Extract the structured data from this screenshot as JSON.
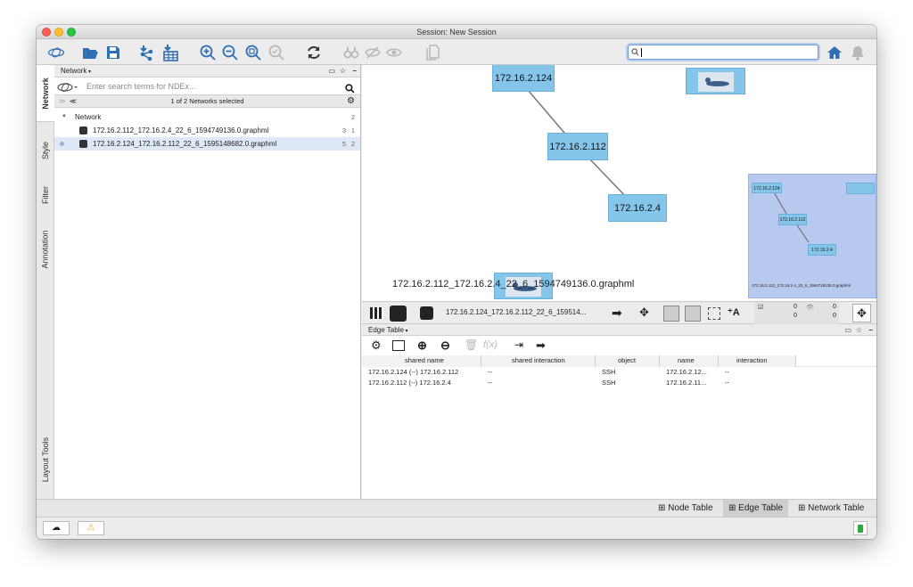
{
  "window": {
    "title": "Session: New Session"
  },
  "toolbar": {
    "search_value": "",
    "colors": {
      "accent": "#2f6fb3",
      "disabled": "#b8b8b8"
    }
  },
  "sidebar": {
    "tabs": [
      {
        "label": "Network",
        "icon": "network-icon"
      },
      {
        "label": "Style",
        "icon": "brush-icon"
      },
      {
        "label": "Filter",
        "icon": "filter-icon"
      },
      {
        "label": "Annotation",
        "icon": "annotation-icon"
      },
      {
        "label": "Layout Tools",
        "icon": "layout-icon"
      }
    ]
  },
  "network_panel": {
    "title": "Network",
    "search_placeholder": "Enter search terms for NDEx...",
    "summary": "1 of 2 Networks selected",
    "collection": {
      "name": "Network",
      "count": "2"
    },
    "networks": [
      {
        "name": "172.16.2.112_172.16.2.4_22_6_1594749136.0.graphml",
        "nodes": "3",
        "edges": "1",
        "selected": false
      },
      {
        "name": "172.16.2.124_172.16.2.112_22_6_1595148682.0.graphml",
        "nodes": "5",
        "edges": "2",
        "selected": true
      }
    ]
  },
  "graph": {
    "nodes": {
      "n124": "172.16.2.124",
      "n112": "172.16.2.112",
      "n4": "172.16.2.4"
    },
    "network_label": "172.16.2.112_172.16.2.4_22_6_1594749136.0.graphml",
    "node_color": "#86c5ea",
    "minimap": {
      "n124": "172.16.2.124",
      "n112": "172.16.2.112",
      "n4": "172.16.2.4",
      "label": "172.16.2.112_172.16.2.4_22_6_1594749136.0.graphml"
    }
  },
  "graph_toolbar": {
    "current_network": "172.16.2.124_172.16.2.112_22_6_159514...",
    "sel_nodes": "0",
    "sel_nodes_total": "0",
    "hidden": "0",
    "hidden_total": "0"
  },
  "edge_table": {
    "title": "Edge Table",
    "columns": [
      "shared name",
      "shared interaction",
      "object",
      "name",
      "interaction"
    ],
    "rows": [
      [
        "172.16.2.124 (--) 172.16.2.112",
        "--",
        "SSH",
        "172.16.2.12...",
        "--"
      ],
      [
        "172.16.2.112 (--) 172.16.2.4",
        "--",
        "SSH",
        "172.16.2.11...",
        "--"
      ]
    ]
  },
  "bottom_tabs": {
    "node": "Node Table",
    "edge": "Edge Table",
    "network": "Network Table"
  }
}
